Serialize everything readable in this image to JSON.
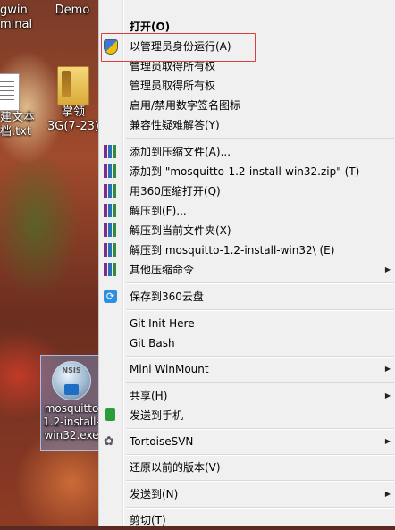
{
  "desktop": {
    "icons": [
      {
        "label_line1": "gwin",
        "label_line2": "minal"
      },
      {
        "label_line1": "Demo"
      },
      {
        "label_line1": "建文本",
        "label_line2": "档.txt"
      },
      {
        "label_line1": "掌领",
        "label_line2": "3G(7-23)"
      },
      {
        "label_line1": "mosquitto",
        "label_line2": "1.2-install-",
        "label_line3": "win32.exe"
      }
    ]
  },
  "menu": {
    "items": [
      {
        "label": "打开(O)",
        "bold": true
      },
      {
        "label": "以管理员身份运行(A)",
        "icon": "uac-shield-icon"
      },
      {
        "label": "管理员取得所有权"
      },
      {
        "label": "管理员取得所有权"
      },
      {
        "label": "启用/禁用数字签名图标"
      },
      {
        "label": "兼容性疑难解答(Y)"
      },
      {
        "label": "添加到压缩文件(A)...",
        "icon": "winrar-icon"
      },
      {
        "label": "添加到 \"mosquitto-1.2-install-win32.zip\" (T)",
        "icon": "winrar-icon"
      },
      {
        "label": "用360压缩打开(Q)",
        "icon": "winrar-icon"
      },
      {
        "label": "解压到(F)...",
        "icon": "winrar-icon"
      },
      {
        "label": "解压到当前文件夹(X)",
        "icon": "winrar-icon"
      },
      {
        "label": "解压到 mosquitto-1.2-install-win32\\ (E)",
        "icon": "winrar-icon"
      },
      {
        "label": "其他压缩命令",
        "icon": "winrar-icon",
        "submenu": true
      },
      {
        "label": "保存到360云盘",
        "icon": "cloud-icon"
      },
      {
        "label": "Git Init Here"
      },
      {
        "label": "Git Bash"
      },
      {
        "label": "Mini WinMount",
        "submenu": true
      },
      {
        "label": "共享(H)",
        "submenu": true
      },
      {
        "label": "发送到手机",
        "icon": "phone-icon"
      },
      {
        "label": "TortoiseSVN",
        "icon": "tortoisesvn-icon",
        "submenu": true
      },
      {
        "label": "还原以前的版本(V)"
      },
      {
        "label": "发送到(N)",
        "submenu": true
      },
      {
        "label": "剪切(T)"
      }
    ]
  },
  "colors": {
    "highlight_border": "#d84040",
    "menu_bg": "#f0f0f0"
  }
}
